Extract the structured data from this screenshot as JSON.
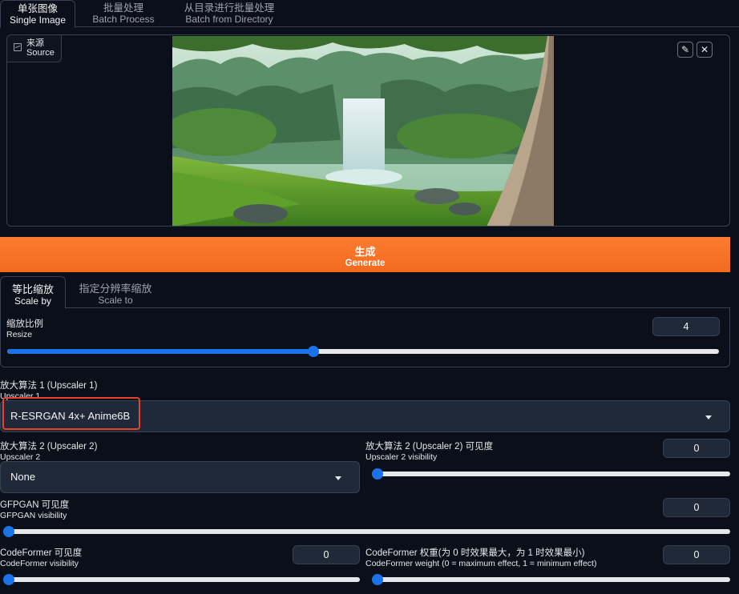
{
  "tabs": [
    {
      "label_cn": "单张图像",
      "label_en": "Single Image",
      "active": true
    },
    {
      "label_cn": "批量处理",
      "label_en": "Batch Process",
      "active": false
    },
    {
      "label_cn": "从目录进行批量处理",
      "label_en": "Batch from Directory",
      "active": false
    }
  ],
  "source": {
    "label_cn": "来源",
    "label_en": "Source",
    "icon": "image-icon",
    "edit_icon": "pencil-icon",
    "clear_icon": "close-icon",
    "edit_glyph": "✎",
    "clear_glyph": "✕"
  },
  "generate": {
    "label_cn": "生成",
    "label_en": "Generate",
    "color": "#f97316"
  },
  "scale_tabs": [
    {
      "label_cn": "等比缩放",
      "label_en": "Scale by",
      "active": true
    },
    {
      "label_cn": "指定分辨率缩放",
      "label_en": "Scale to",
      "active": false
    }
  ],
  "resize": {
    "label_cn": "缩放比例",
    "label_en": "Resize",
    "value": "4",
    "slider_fraction": 0.43
  },
  "upscaler1": {
    "label_cn": "放大算法 1 (Upscaler 1)",
    "label_en": "Upscaler 1",
    "value": "R-ESRGAN 4x+ Anime6B"
  },
  "upscaler2": {
    "label_cn": "放大算法 2 (Upscaler 2)",
    "label_en": "Upscaler 2",
    "value": "None"
  },
  "upscaler2_visibility": {
    "label_cn": "放大算法 2 (Upscaler 2) 可见度",
    "label_en": "Upscaler 2 visibility",
    "value": "0",
    "slider_fraction": 0
  },
  "gfpgan": {
    "label_cn": "GFPGAN 可见度",
    "label_en": "GFPGAN visibility",
    "value": "0",
    "slider_fraction": 0
  },
  "codeformer_visibility": {
    "label_cn": "CodeFormer 可见度",
    "label_en": "CodeFormer visibility",
    "value": "0",
    "slider_fraction": 0
  },
  "codeformer_weight": {
    "label_cn": "CodeFormer 权重(为 0 时效果最大，为 1 时效果最小)",
    "label_en": "CodeFormer weight (0 = maximum effect, 1 = minimum effect)",
    "value": "0",
    "slider_fraction": 0
  },
  "accent_color": "#1a73e8",
  "highlight_color": "#e8412c"
}
